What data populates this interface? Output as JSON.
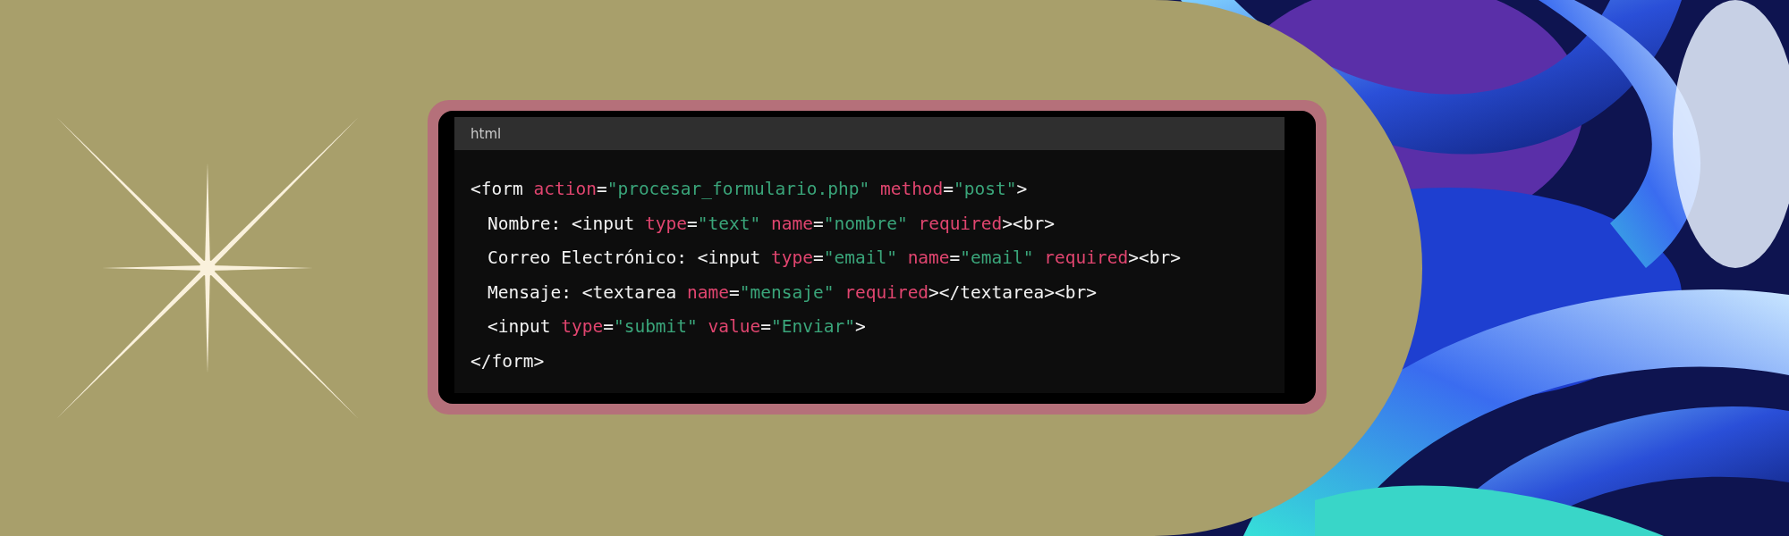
{
  "code_block": {
    "language": "html",
    "lines": [
      {
        "tokens": [
          {
            "kind": "plain",
            "text": "<form "
          },
          {
            "kind": "attr",
            "text": "action"
          },
          {
            "kind": "plain",
            "text": "="
          },
          {
            "kind": "string",
            "text": "\"procesar_formulario.php\" "
          },
          {
            "kind": "attr",
            "text": "method"
          },
          {
            "kind": "plain",
            "text": "="
          },
          {
            "kind": "string",
            "text": "\"post\""
          },
          {
            "kind": "plain",
            "text": ">"
          }
        ],
        "children": [
          {
            "tokens": [
              {
                "kind": "plain",
                "text": "Nombre: <input "
              },
              {
                "kind": "attr",
                "text": "type"
              },
              {
                "kind": "plain",
                "text": "="
              },
              {
                "kind": "string",
                "text": "\"text\" "
              },
              {
                "kind": "attr",
                "text": "name"
              },
              {
                "kind": "plain",
                "text": "="
              },
              {
                "kind": "string",
                "text": "\"nombre\" "
              },
              {
                "kind": "attr",
                "text": "required"
              },
              {
                "kind": "plain",
                "text": "><br>"
              }
            ]
          },
          {
            "tokens": [
              {
                "kind": "plain",
                "text": "Correo Electrónico: <input "
              },
              {
                "kind": "attr",
                "text": "type"
              },
              {
                "kind": "plain",
                "text": "="
              },
              {
                "kind": "string",
                "text": "\"email\" "
              },
              {
                "kind": "attr",
                "text": "name"
              },
              {
                "kind": "plain",
                "text": "="
              },
              {
                "kind": "string",
                "text": "\"email\" "
              },
              {
                "kind": "attr",
                "text": "required"
              },
              {
                "kind": "plain",
                "text": "><br>"
              }
            ]
          },
          {
            "tokens": [
              {
                "kind": "plain",
                "text": "Mensaje: <textarea "
              },
              {
                "kind": "attr",
                "text": "name"
              },
              {
                "kind": "plain",
                "text": "="
              },
              {
                "kind": "string",
                "text": "\"mensaje\" "
              },
              {
                "kind": "attr",
                "text": "required"
              },
              {
                "kind": "plain",
                "text": "></textarea><br>"
              }
            ]
          },
          {
            "tokens": [
              {
                "kind": "plain",
                "text": "<input "
              },
              {
                "kind": "attr",
                "text": "type"
              },
              {
                "kind": "plain",
                "text": "="
              },
              {
                "kind": "string",
                "text": "\"submit\" "
              },
              {
                "kind": "attr",
                "text": "value"
              },
              {
                "kind": "plain",
                "text": "="
              },
              {
                "kind": "string",
                "text": "\"Enviar\""
              },
              {
                "kind": "plain",
                "text": ">"
              }
            ]
          }
        ]
      },
      {
        "tokens": [
          {
            "kind": "plain",
            "text": "</form>"
          }
        ]
      }
    ]
  }
}
